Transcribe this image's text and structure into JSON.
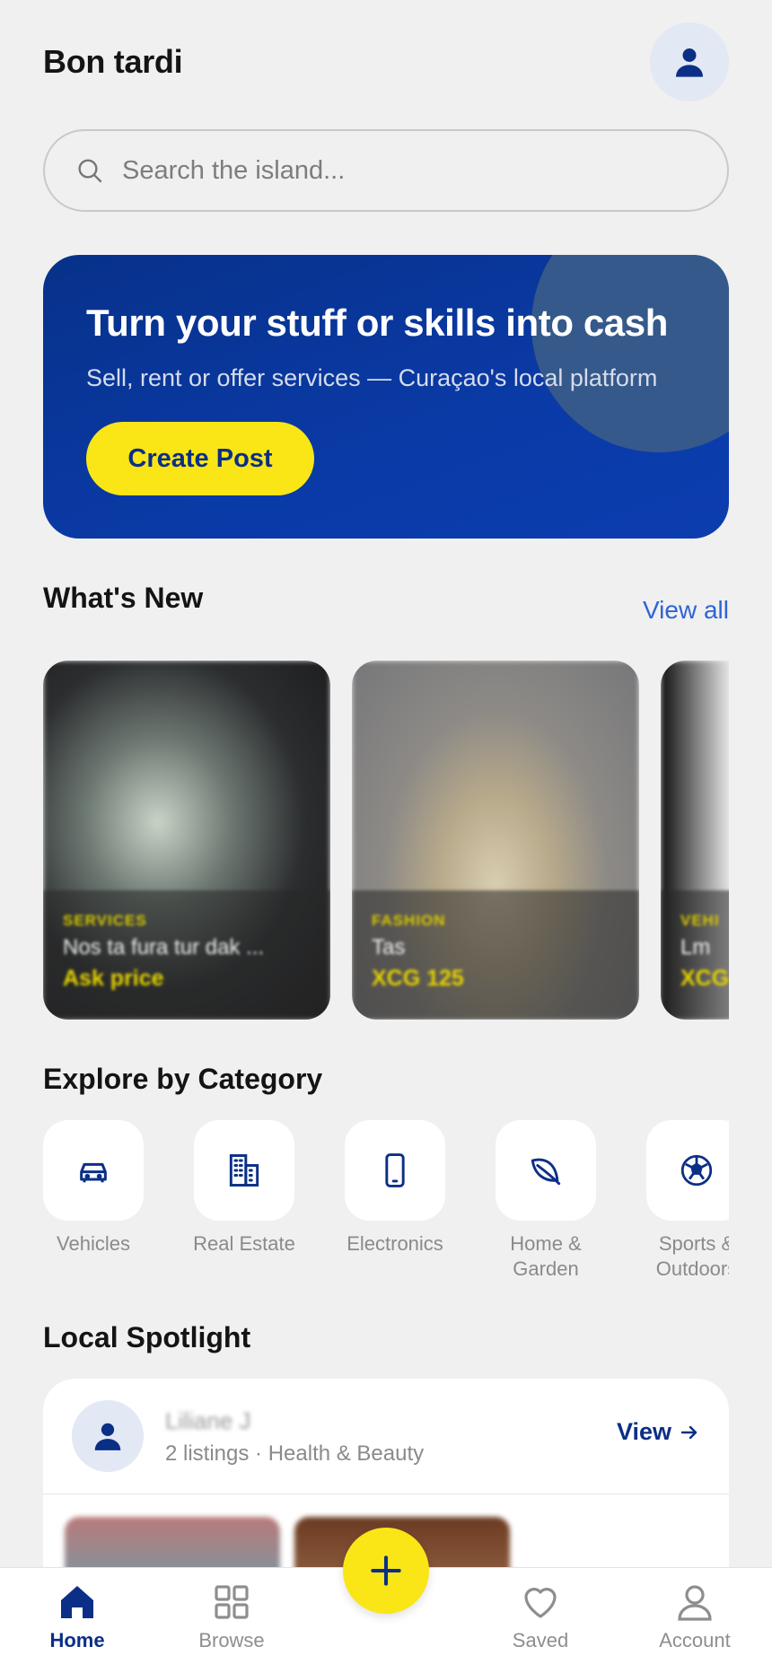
{
  "header": {
    "greeting": "Bon tardi",
    "avatar_icon": "user-icon"
  },
  "search": {
    "placeholder": "Search the island...",
    "icon": "search-icon"
  },
  "hero": {
    "title": "Turn your stuff or skills into cash",
    "subtitle": "Sell, rent or offer services — Curaçao's local platform",
    "button_label": "Create Post"
  },
  "whats_new": {
    "title": "What's New",
    "view_all": "View all",
    "items": [
      {
        "category": "SERVICES",
        "title": "Nos ta fura tur dak ...",
        "price": "Ask price"
      },
      {
        "category": "FASHION",
        "title": "Tas",
        "price": "XCG 125"
      },
      {
        "category": "VEHI",
        "title": "Lm",
        "price": "XCG"
      }
    ]
  },
  "categories": {
    "title": "Explore by Category",
    "items": [
      {
        "label": "Vehicles",
        "icon": "car-icon"
      },
      {
        "label": "Real Estate",
        "icon": "building-icon"
      },
      {
        "label": "Electronics",
        "icon": "phone-icon"
      },
      {
        "label": "Home & Garden",
        "icon": "leaf-icon"
      },
      {
        "label": "Sports & Outdoors",
        "icon": "ball-icon"
      }
    ]
  },
  "spotlight": {
    "title": "Local Spotlight",
    "seller_name": "Liliane J",
    "meta": "2 listings · Health & Beauty",
    "view_label": "View"
  },
  "nav": {
    "items": [
      {
        "label": "Home",
        "icon": "home-icon"
      },
      {
        "label": "Browse",
        "icon": "grid-icon"
      },
      {
        "label": "Saved",
        "icon": "heart-icon"
      },
      {
        "label": "Account",
        "icon": "account-icon"
      }
    ],
    "fab_icon": "plus-icon"
  },
  "colors": {
    "primary": "#0b2f86",
    "accent": "#fae616",
    "link": "#2f63d6",
    "background": "#f0f0f0"
  }
}
